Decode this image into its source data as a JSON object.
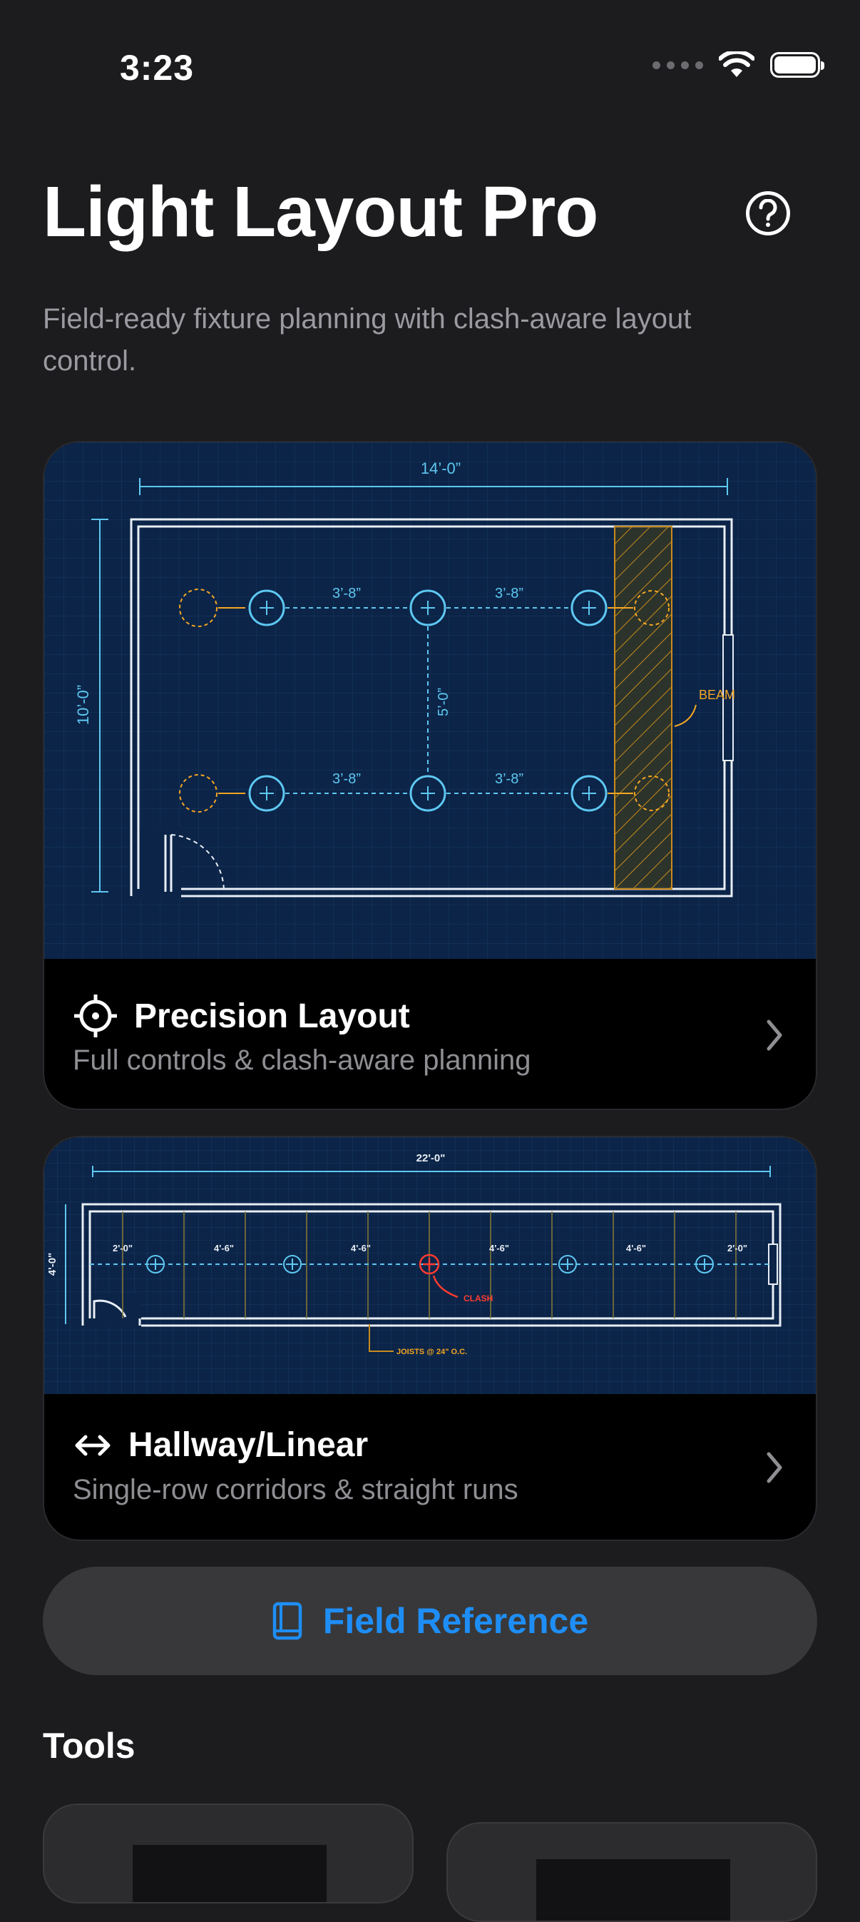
{
  "status_bar": {
    "time": "3:23"
  },
  "header": {
    "title": "Light Layout Pro",
    "subtitle": "Field-ready fixture planning with clash-aware layout control.",
    "help_icon": "question-circle-icon"
  },
  "colors": {
    "background": "#1c1c1e",
    "accent": "#1e8ef6",
    "blueprint": "#0b2447",
    "blueprint_line": "#5ec8f2",
    "warning": "#f5a623",
    "clash": "#ff3b30"
  },
  "cards": [
    {
      "title": "Precision Layout",
      "description": "Full controls & clash-aware planning",
      "icon": "crosshair-icon",
      "diagram": {
        "width_label": "14’-0”",
        "height_label": "10’-0”",
        "spacing_label": "3’-8”",
        "row_spacing_label": "5’-0”",
        "beam_label": "BEAM"
      }
    },
    {
      "title": "Hallway/Linear",
      "description": "Single-row corridors & straight runs",
      "icon": "arrows-left-right-icon",
      "diagram": {
        "width_label": "22'-0\"",
        "height_label": "4'-0\"",
        "end_label": "2'-0\"",
        "spacing_label": "4'-6\"",
        "clash_label": "CLASH",
        "joist_label": "JOISTS @ 24\" O.C."
      }
    }
  ],
  "field_reference": {
    "label": "Field Reference",
    "icon": "book-icon"
  },
  "tools": {
    "title": "Tools"
  }
}
